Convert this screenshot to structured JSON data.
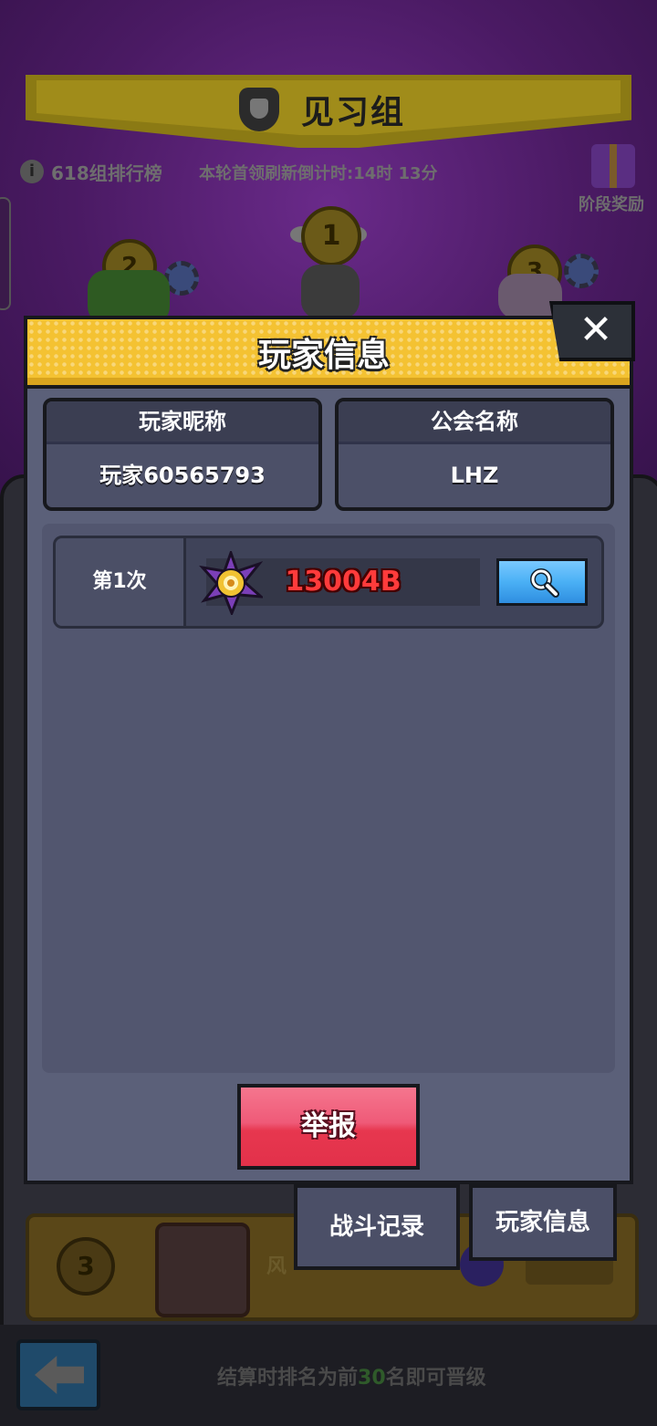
{
  "background": {
    "league_title": "见习组",
    "leaderboard_label": "618组排行榜",
    "countdown": "本轮首领刷新倒计时:14时 13分",
    "stage_reward_label": "阶段奖励",
    "podium": [
      "2",
      "1",
      "3"
    ],
    "row_rank": "3",
    "row_name": "风",
    "bottom_hint_prefix": "结算时排名为前",
    "bottom_hint_number": "30",
    "bottom_hint_suffix": "名即可晋级"
  },
  "modal": {
    "title": "玩家信息",
    "close_label": "✕",
    "nickname_header": "玩家昵称",
    "nickname_value": "玩家60565793",
    "guild_header": "公会名称",
    "guild_value": "LHZ",
    "records": [
      {
        "label": "第1次",
        "value": "13004B"
      }
    ],
    "report_label": "举报"
  },
  "menu": {
    "battle_record": "战斗记录",
    "player_info": "玩家信息"
  },
  "colors": {
    "header_yellow": "#f4c232",
    "report_red": "#e7374f",
    "search_blue": "#4ab0f5",
    "damage_red": "#ff3b3b",
    "panel_slate": "#5b6079"
  }
}
